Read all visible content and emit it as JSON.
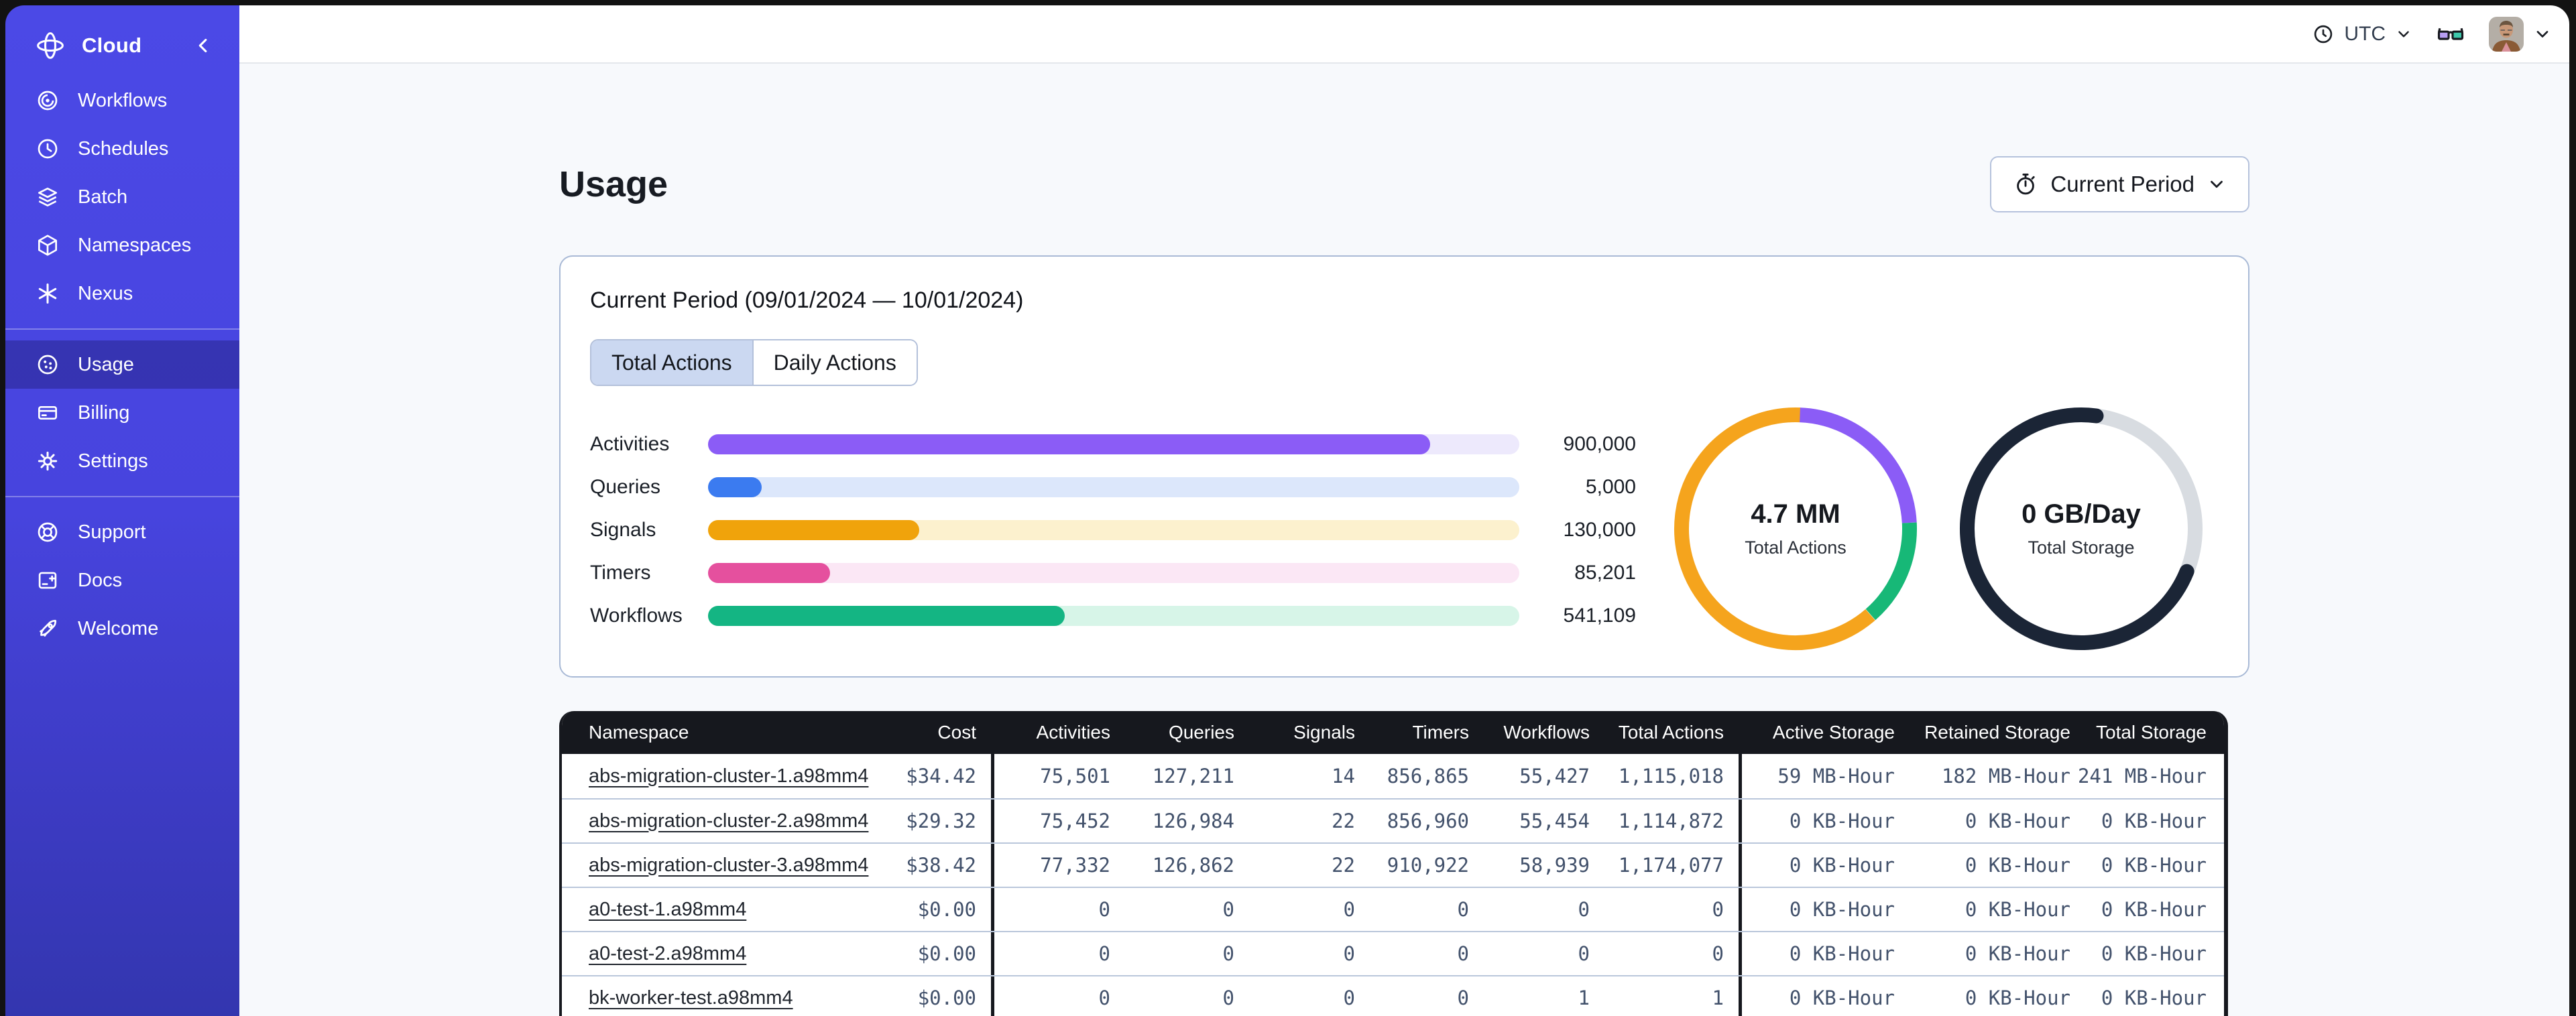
{
  "sidebar": {
    "brand": "Cloud",
    "brand_icon": "temporal-logo-icon",
    "collapse_icon": "chevron-left-icon",
    "background_top": "#4B49E6",
    "background_bottom": "#3336AF",
    "sections": [
      {
        "items": [
          {
            "label": "Workflows",
            "icon": "workflows-icon",
            "selected": false
          },
          {
            "label": "Schedules",
            "icon": "schedules-icon",
            "selected": false
          },
          {
            "label": "Batch",
            "icon": "batch-icon",
            "selected": false
          },
          {
            "label": "Namespaces",
            "icon": "namespaces-icon",
            "selected": false
          },
          {
            "label": "Nexus",
            "icon": "nexus-icon",
            "selected": false
          }
        ]
      },
      {
        "items": [
          {
            "label": "Usage",
            "icon": "usage-icon",
            "selected": true
          },
          {
            "label": "Billing",
            "icon": "billing-icon",
            "selected": false
          },
          {
            "label": "Settings",
            "icon": "settings-icon",
            "selected": false
          }
        ]
      },
      {
        "items": [
          {
            "label": "Support",
            "icon": "support-icon",
            "selected": false
          },
          {
            "label": "Docs",
            "icon": "docs-icon",
            "selected": false
          },
          {
            "label": "Welcome",
            "icon": "welcome-icon",
            "selected": false
          }
        ]
      }
    ]
  },
  "topbar": {
    "timezone": "UTC",
    "timezone_icon": "clock-icon",
    "icons": [
      "glasses-icon",
      "avatar",
      "chevron-down-icon"
    ]
  },
  "page": {
    "title": "Usage",
    "period_button_label": "Current Period",
    "period_button_icon": "stopwatch-icon"
  },
  "usage_card": {
    "title": "Current Period (09/01/2024 — 10/01/2024)",
    "tabs": [
      {
        "label": "Total Actions",
        "selected": true
      },
      {
        "label": "Daily Actions",
        "selected": false
      }
    ]
  },
  "chart_data": [
    {
      "type": "bar",
      "orientation": "horizontal",
      "categories": [
        "Activities",
        "Queries",
        "Signals",
        "Timers",
        "Workflows"
      ],
      "values": [
        900000,
        5000,
        130000,
        85201,
        541109
      ],
      "display_values": [
        "900,000",
        "5,000",
        "130,000",
        "85,201",
        "541,109"
      ],
      "percent_filled": [
        89,
        6.6,
        26,
        15,
        44
      ],
      "bar_colors": [
        "#8B5CF6",
        "#3B7BF0",
        "#F0A30B",
        "#E5509E",
        "#14B583"
      ],
      "track_colors": [
        "#EDE9FC",
        "#DCE7FB",
        "#FCF1CE",
        "#FBE7F5",
        "#D7F5E8"
      ],
      "grid": false
    },
    {
      "type": "donut",
      "center_value": "4.7 MM",
      "center_label": "Total Actions",
      "rounded_caps": false,
      "segments": [
        {
          "name": "activities",
          "color": "#8B5CF6",
          "start_deg": 2,
          "percent": 23.6
        },
        {
          "name": "workflows",
          "color": "#17B877",
          "start_deg": 87,
          "percent": 14.4
        },
        {
          "name": "signals",
          "color": "#F5A41D",
          "start_deg": 139,
          "percent": 62.0
        }
      ]
    },
    {
      "type": "donut",
      "center_value": "0 GB/Day",
      "center_label": "Total Storage",
      "rounded_caps": true,
      "track_color": "#D8DCE1",
      "segments": [
        {
          "name": "storage",
          "color": "#1B2536",
          "start_deg": 112,
          "percent": 71.0
        }
      ]
    }
  ],
  "table": {
    "header_background": "#16181e",
    "columns": [
      "Namespace",
      "Cost",
      "Activities",
      "Queries",
      "Signals",
      "Timers",
      "Workflows",
      "Total Actions",
      "Active Storage",
      "Retained Storage",
      "Total Storage"
    ],
    "rows": [
      [
        "abs-migration-cluster-1.a98mm4",
        "$34.42",
        "75,501",
        "127,211",
        "14",
        "856,865",
        "55,427",
        "1,115,018",
        "59 MB-Hour",
        "182 MB-Hour",
        "241 MB-Hour"
      ],
      [
        "abs-migration-cluster-2.a98mm4",
        "$29.32",
        "75,452",
        "126,984",
        "22",
        "856,960",
        "55,454",
        "1,114,872",
        "0 KB-Hour",
        "0 KB-Hour",
        "0 KB-Hour"
      ],
      [
        "abs-migration-cluster-3.a98mm4",
        "$38.42",
        "77,332",
        "126,862",
        "22",
        "910,922",
        "58,939",
        "1,174,077",
        "0 KB-Hour",
        "0 KB-Hour",
        "0 KB-Hour"
      ],
      [
        "a0-test-1.a98mm4",
        "$0.00",
        "0",
        "0",
        "0",
        "0",
        "0",
        "0",
        "0 KB-Hour",
        "0 KB-Hour",
        "0 KB-Hour"
      ],
      [
        "a0-test-2.a98mm4",
        "$0.00",
        "0",
        "0",
        "0",
        "0",
        "0",
        "0",
        "0 KB-Hour",
        "0 KB-Hour",
        "0 KB-Hour"
      ],
      [
        "bk-worker-test.a98mm4",
        "$0.00",
        "0",
        "0",
        "0",
        "0",
        "1",
        "1",
        "0 KB-Hour",
        "0 KB-Hour",
        "0 KB-Hour"
      ]
    ]
  }
}
